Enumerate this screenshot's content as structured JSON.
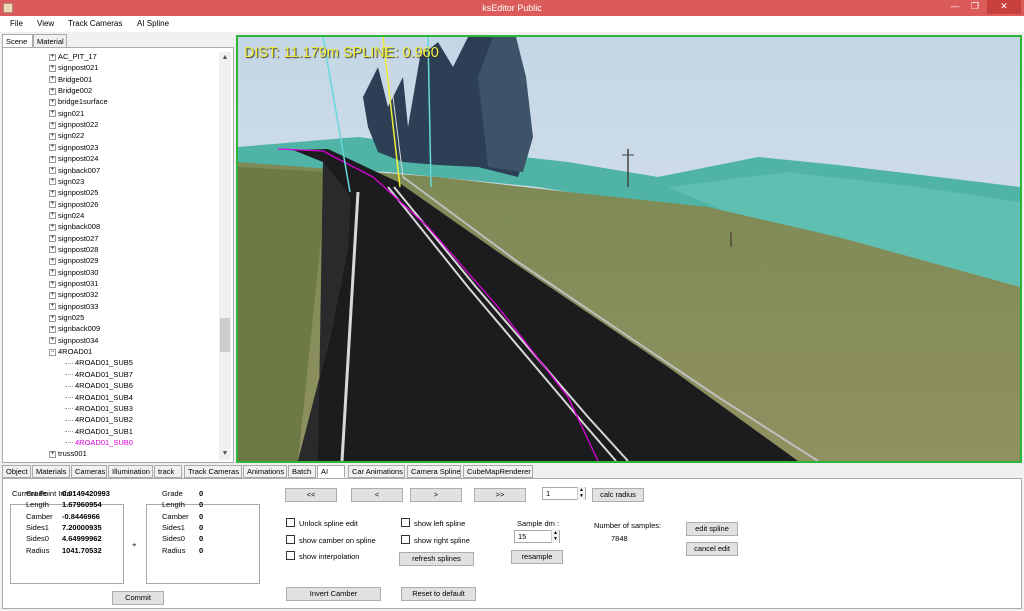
{
  "window": {
    "title": "ksEditor Public",
    "min_glyph": "—",
    "max_glyph": "❐",
    "close_glyph": "✕"
  },
  "menu": [
    "File",
    "View",
    "Track Cameras",
    "AI Spline"
  ],
  "left_tabs": [
    "Scene",
    "Material"
  ],
  "tree": {
    "collapsed": [
      "AC_PIT_17",
      "signpost021",
      "Bridge001",
      "Bridge002",
      "bridge1surface",
      "sign021",
      "signpost022",
      "sign022",
      "signpost023",
      "signpost024",
      "signback007",
      "sign023",
      "signpost025",
      "signpost026",
      "sign024",
      "signback008",
      "signpost027",
      "signpost028",
      "signpost029",
      "signpost030",
      "signpost031",
      "signpost032",
      "signpost033",
      "sign025",
      "signback009",
      "signpost034"
    ],
    "expanded_parent": "4ROAD01",
    "children": [
      "4ROAD01_SUB5",
      "4ROAD01_SUB7",
      "4ROAD01_SUB6",
      "4ROAD01_SUB4",
      "4ROAD01_SUB3",
      "4ROAD01_SUB2",
      "4ROAD01_SUB1",
      "4ROAD01_SUB0"
    ],
    "selected": "4ROAD01_SUB0",
    "next": "truss001",
    "expand_glyph": "+",
    "collapse_glyph": "−"
  },
  "hud_text": "DIST: 11.179m SPLINE: 0.960",
  "bottom_tabs": [
    "Object",
    "Materials",
    "Cameras",
    "Illumination",
    "track",
    "Track Cameras",
    "Animations",
    "Batch",
    "AI",
    "Car Animations",
    "Camera Spline",
    "CubeMapRenderer"
  ],
  "active_tab": "AI",
  "ai": {
    "current_point_label": "Current Point  Info :",
    "left_fields": [
      {
        "k": "Grade",
        "v": "0.0149420993"
      },
      {
        "k": "Length",
        "v": "1.67960954"
      },
      {
        "k": "Camber",
        "v": "-0.8446966"
      },
      {
        "k": "Sides1",
        "v": "7.20000935"
      },
      {
        "k": "Sides0",
        "v": "4.64999962"
      },
      {
        "k": "Radius",
        "v": "1041.70532"
      }
    ],
    "plus": "+",
    "right_fields": [
      {
        "k": "Grade",
        "v": "0"
      },
      {
        "k": "Length",
        "v": "0"
      },
      {
        "k": "Camber",
        "v": "0"
      },
      {
        "k": "Sides1",
        "v": "0"
      },
      {
        "k": "Sides0",
        "v": "0"
      },
      {
        "k": "Radius",
        "v": "0"
      }
    ],
    "commit": "Commit",
    "nav": [
      "<<",
      "<",
      ">",
      ">>"
    ],
    "step_value": "1",
    "calc_radius": "calc radius",
    "checks_left": [
      "Unlock spline edit",
      "show camber on spline",
      "show interpolation"
    ],
    "checks_right": [
      "show left spline",
      "show right spline"
    ],
    "refresh": "refresh splines",
    "sample_label": "Sample dm :",
    "sample_value": "15",
    "resample": "resample",
    "samples_label": "Number of samples:",
    "samples_value": "7848",
    "edit_spline": "edit spline",
    "cancel_edit": "cancel edit",
    "invert_camber": "Invert Camber",
    "reset": "Reset to default"
  },
  "colors": {
    "accent": "#2db53a",
    "selected_item": "#d900d9",
    "hud": "#f1ee3a",
    "titlebar": "#db5a5a"
  }
}
